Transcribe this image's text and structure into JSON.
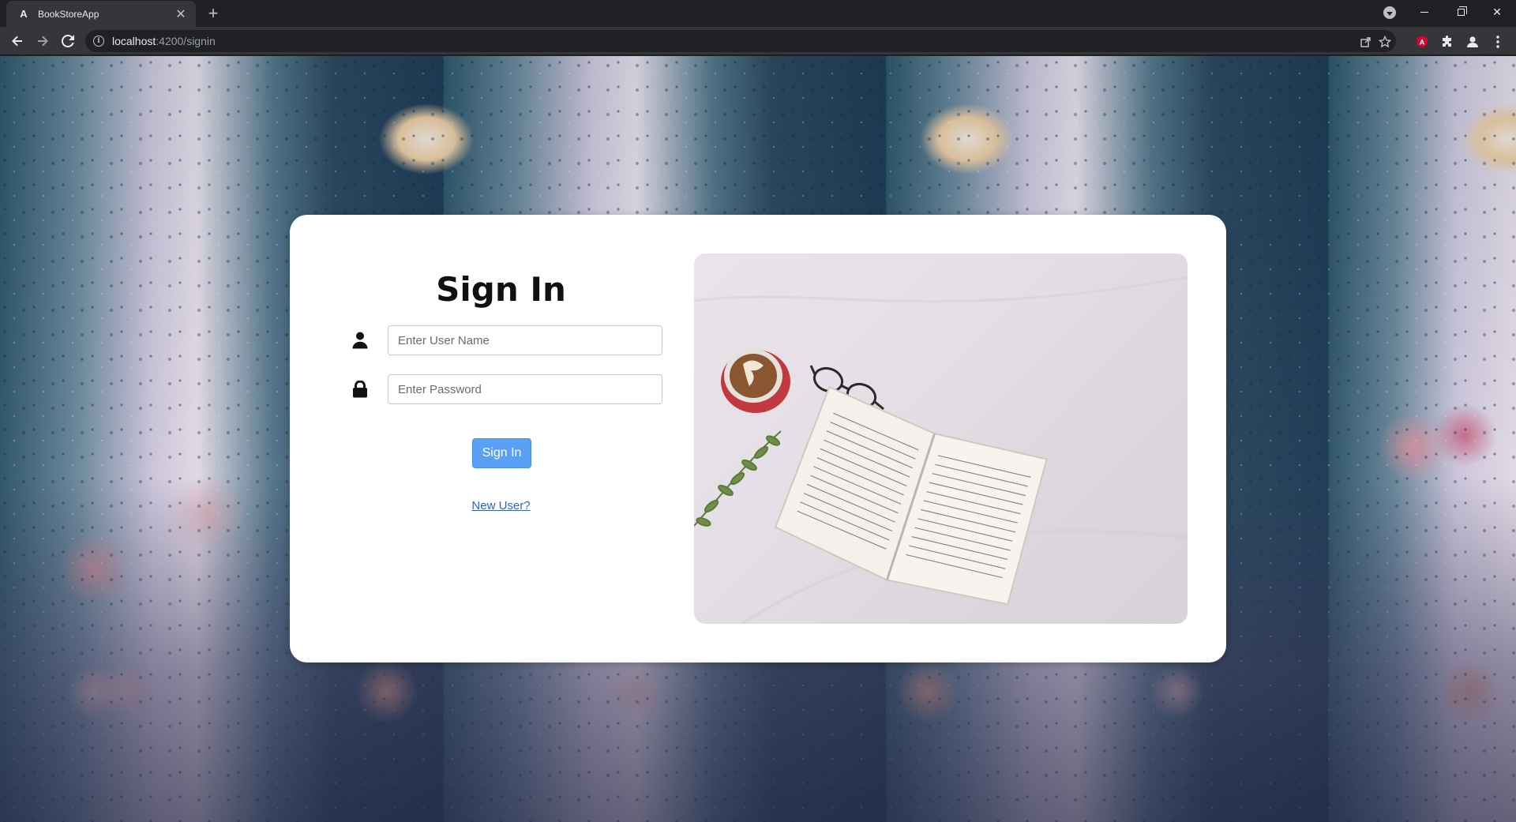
{
  "browser": {
    "tab_title": "BookStoreApp",
    "tab_favicon": "A",
    "url_host": "localhost",
    "url_path": ":4200/signin"
  },
  "signin": {
    "title": "Sign In",
    "username_placeholder": "Enter User Name",
    "password_placeholder": "Enter Password",
    "button_label": "Sign In",
    "new_user_link": "New User?"
  },
  "colors": {
    "primary_button": "#5aa0f5",
    "link": "#2f66c4",
    "card_background": "#ffffff"
  },
  "icons": {
    "username_field": "user-icon",
    "password_field": "lock-icon"
  }
}
